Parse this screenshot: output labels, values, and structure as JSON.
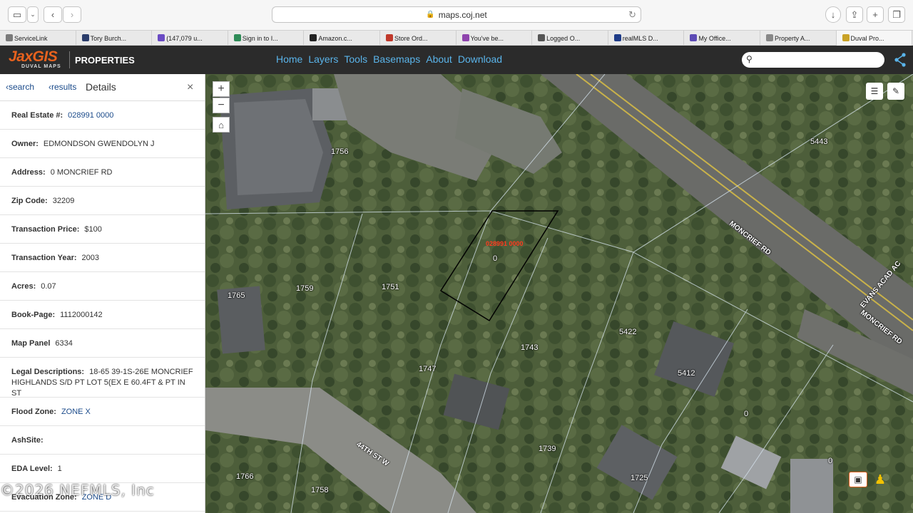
{
  "browser": {
    "url": "maps.coj.net",
    "bookmarks": [
      {
        "label": "ServiceLink",
        "color": "#7a7a7a"
      },
      {
        "label": "Tory Burch...",
        "color": "#2b3d6b"
      },
      {
        "label": "(147,079 u...",
        "color": "#6a4bc4"
      },
      {
        "label": "Sign in to I...",
        "color": "#2e8b57"
      },
      {
        "label": "Amazon.c...",
        "color": "#222222"
      },
      {
        "label": "Store Ord...",
        "color": "#c0392b"
      },
      {
        "label": "You've be...",
        "color": "#8e44ad"
      },
      {
        "label": "Logged O...",
        "color": "#555555"
      },
      {
        "label": "realMLS D...",
        "color": "#1f3c88"
      },
      {
        "label": "My Office...",
        "color": "#5d4bb5"
      },
      {
        "label": "Property A...",
        "color": "#888888"
      },
      {
        "label": "Duval Pro...",
        "color": "#c9a227"
      }
    ]
  },
  "app": {
    "logo": "JaxGIS",
    "logo_sub": "DUVAL MAPS",
    "title": "PROPERTIES",
    "nav": [
      "Home",
      "Layers",
      "Tools",
      "Basemaps",
      "About",
      "Download"
    ],
    "search_placeholder": ""
  },
  "panel": {
    "search_link": "search",
    "results_link": "results",
    "title": "Details",
    "close": "×",
    "fields": [
      {
        "label": "Real Estate #:",
        "value": "028991 0000",
        "link": true
      },
      {
        "label": "Owner:",
        "value": "EDMONDSON GWENDOLYN J",
        "link": false
      },
      {
        "label": "Address:",
        "value": "0 MONCRIEF RD",
        "link": false
      },
      {
        "label": "Zip Code:",
        "value": "32209",
        "link": false
      },
      {
        "label": "Transaction Price:",
        "value": "$100",
        "link": false
      },
      {
        "label": "Transaction Year:",
        "value": "2003",
        "link": false
      },
      {
        "label": "Acres:",
        "value": "0.07",
        "link": false
      },
      {
        "label": "Book-Page:",
        "value": "1112000142",
        "link": false
      },
      {
        "label": "Map Panel",
        "value": "6334",
        "link": false
      },
      {
        "label": "Legal Descriptions:",
        "value": "18-65 39-1S-26E MONCRIEF HIGHLANDS S/D PT LOT 5(EX E 60.4FT & PT IN ST",
        "link": false,
        "tall": true
      },
      {
        "label": "Flood Zone:",
        "value": "ZONE X",
        "link": true
      },
      {
        "label": "AshSite:",
        "value": "",
        "link": false
      },
      {
        "label": "EDA Level:",
        "value": "1",
        "link": false
      },
      {
        "label": "Evacuation Zone:",
        "value": "ZONE D",
        "link": true
      }
    ]
  },
  "map": {
    "zoom_in": "+",
    "zoom_out": "−",
    "parcel_labels": [
      "1756",
      "5443",
      "1765",
      "1759",
      "1751",
      "0",
      "5422",
      "1743",
      "1747",
      "5412",
      "0",
      "1739",
      "0",
      "1766",
      "1725",
      "1758"
    ],
    "selected_parcel": "028991 0000",
    "roads": [
      "MONCRIEF RD",
      "EVANS ACAD AC",
      "MONCRIEF RD",
      "44TH ST W"
    ]
  },
  "watermark": "©2026 NEFMLS, Inc"
}
